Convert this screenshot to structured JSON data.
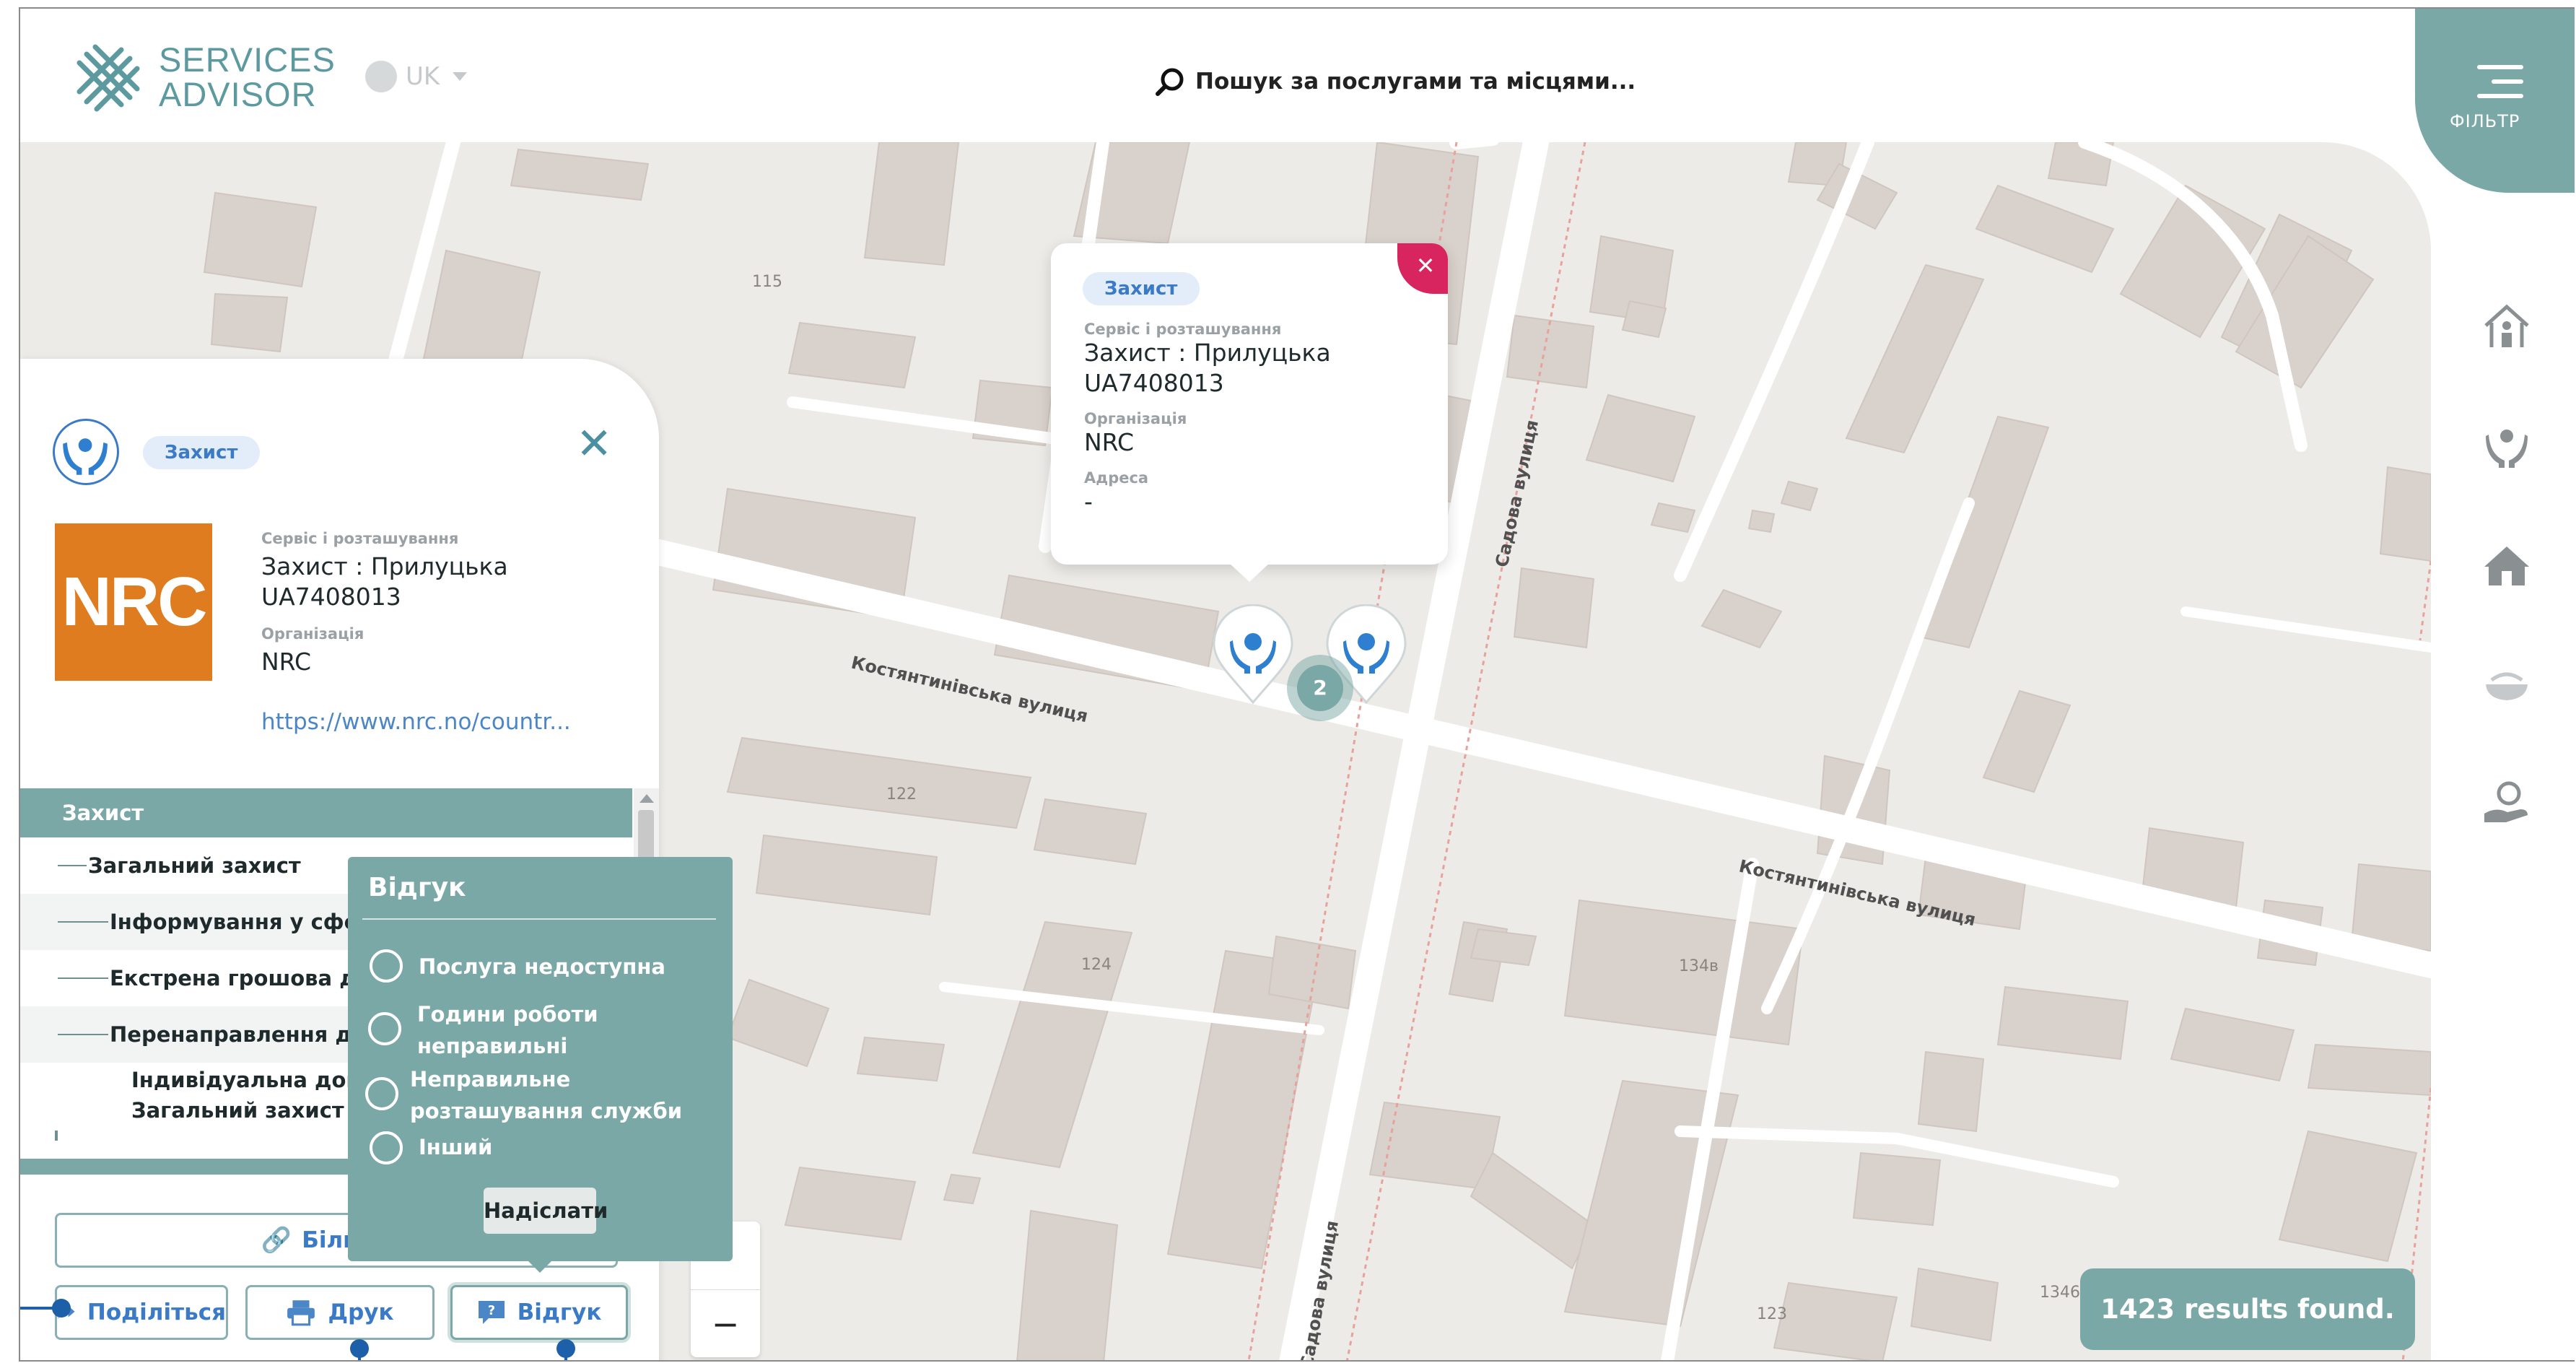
{
  "header": {
    "logo_line1": "SERVICES",
    "logo_line2": "ADVISOR",
    "language": "UK",
    "search_placeholder": "Пошук за послугами та місцями..."
  },
  "filter": {
    "label": "ФІЛЬТР"
  },
  "side_icons": [
    "shelter-icon",
    "protection-hands-icon",
    "housing-icon",
    "food-icon",
    "cash-assistance-icon"
  ],
  "map": {
    "street_labels": [
      "Костянтинівська вулиця",
      "Костянтинівська вулиця",
      "Садова вулиця",
      "Садова вулиця"
    ],
    "building_numbers": [
      "115",
      "122",
      "124",
      "134в",
      "123",
      "1346"
    ],
    "cluster_count": "2"
  },
  "popup": {
    "tag": "Захист",
    "service_label": "Сервіс і розташування",
    "service_line1": "Захист : Прилуцька",
    "service_line2": "UA7408013",
    "org_label": "Організація",
    "org_value": "NRC",
    "address_label": "Адреса",
    "address_value": "-"
  },
  "panel": {
    "tag": "Захист",
    "service_label": "Сервіс і розташування",
    "service_line1": "Захист : Прилуцька",
    "service_line2": "UA7408013",
    "org_label": "Організація",
    "org_value": "NRC",
    "logo_text": "NRC",
    "url": "https://www.nrc.no/countr...",
    "tree_header": "Захист",
    "tree_items": [
      "Загальний захист",
      "Інформування у сфер",
      "Екстрена грошова доп",
      "Перенаправлення до",
      "Індивідуальна допо",
      "Загальний захист"
    ],
    "more_button": "Більше і",
    "share_button": "Поділіться",
    "print_button": "Друк",
    "feedback_button": "Відгук"
  },
  "feedback": {
    "title": "Відгук",
    "options": [
      "Послуга недоступна",
      "Години роботи неправильні",
      "Неправильне розташування служби",
      "Інший"
    ],
    "submit": "Надіслати"
  },
  "zoom": {
    "minus": "−"
  },
  "results": "1423 results found."
}
